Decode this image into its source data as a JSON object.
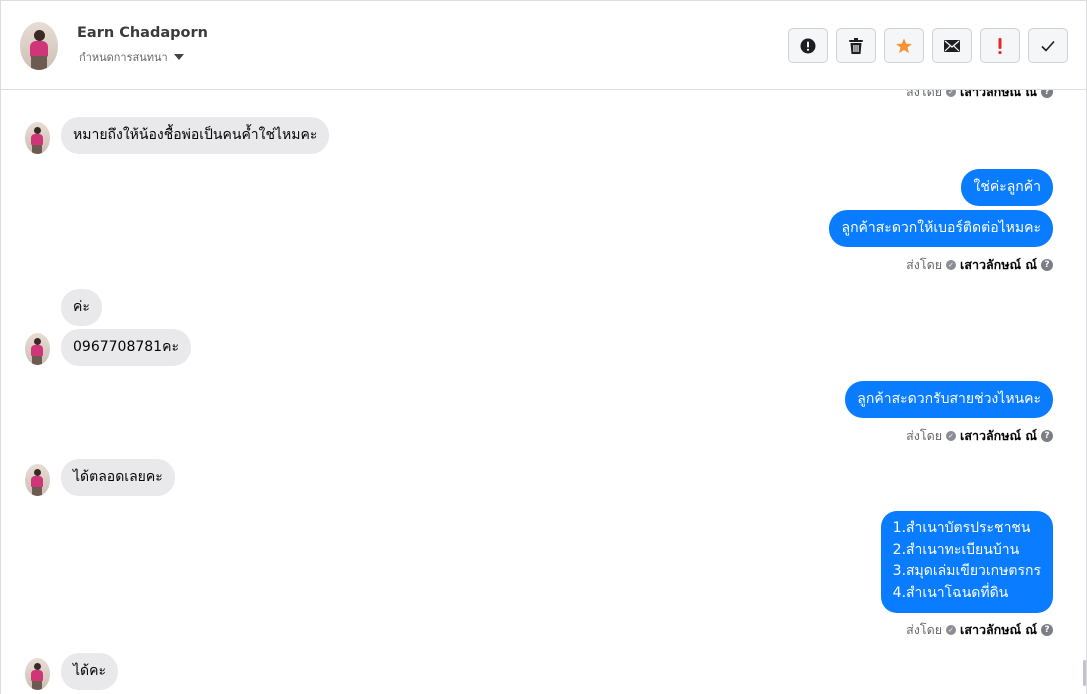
{
  "header": {
    "contact_name": "Earn Chadaporn",
    "contact_subtitle": "กำหนดการสนทนา",
    "toolbar": [
      {
        "name": "spam-report-button",
        "icon": "exclamation-circle-icon"
      },
      {
        "name": "delete-button",
        "icon": "trash-icon"
      },
      {
        "name": "star-button",
        "icon": "star-icon"
      },
      {
        "name": "mark-unread-button",
        "icon": "envelope-icon"
      },
      {
        "name": "flag-button",
        "icon": "exclamation-icon"
      },
      {
        "name": "mark-done-button",
        "icon": "check-icon"
      }
    ]
  },
  "chat": {
    "sent_by_prefix": "ส่งโดย",
    "agent_name": "เสาวลักษณ์ ณ์",
    "messages": {
      "top_partial_agent": "เสาวลักษณ์ ณ์",
      "in_1": "หมายถึงให้น้องชื้อพ่อเป็นคนค้ำใช่ไหมคะ",
      "out_1": "ใช่ค่ะลูกค้า",
      "out_2": "ลูกค้าสะดวกให้เบอร์ติดต่อไหมคะ",
      "in_2": "ค่ะ",
      "in_3": "0967708781คะ",
      "out_3": "ลูกค้าสะดวกรับสายช่วงไหนคะ",
      "in_4": "ได้ตลอดเลยคะ",
      "out_4_lines": [
        "1.สำเนาบัตรประชาชน",
        "2.สำเนาทะเบียนบ้าน",
        "3.สมุดเล่มเขียวเกษตรกร",
        "4.สำเนาโฉนดที่ดิน"
      ],
      "in_5": "ได้คะ"
    }
  },
  "colors": {
    "outgoing_bubble": "#0a7cff",
    "incoming_bubble": "#e9e9eb",
    "star": "#f7923a",
    "flag": "#e4282f"
  }
}
